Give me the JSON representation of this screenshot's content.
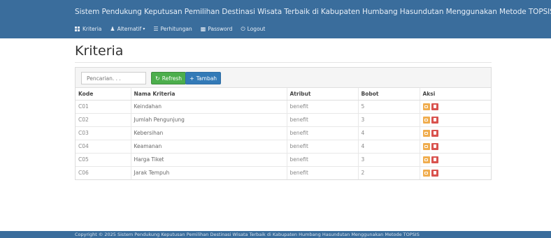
{
  "header": {
    "app_title": "Sistem Pendukung Keputusan Pemilihan Destinasi Wisata Terbaik di Kabupaten Humbang Hasundutan Menggunakan Metode TOPSIS"
  },
  "menu": {
    "kriteria": "Kriteria",
    "alternatif": "Alternatif",
    "perhitungan": "Perhitungan",
    "password": "Password",
    "logout": "Logout"
  },
  "page": {
    "title": "Kriteria"
  },
  "toolbar": {
    "search_placeholder": "Pencarian. . .",
    "refresh_label": "Refresh",
    "add_label": "Tambah"
  },
  "table": {
    "headers": [
      "Kode",
      "Nama Kriteria",
      "Atribut",
      "Bobot",
      "Aksi"
    ],
    "rows": [
      {
        "kode": "C01",
        "nama": "Keindahan",
        "atribut": "benefit",
        "bobot": "5"
      },
      {
        "kode": "C02",
        "nama": "Jumlah Pengunjung",
        "atribut": "benefit",
        "bobot": "3"
      },
      {
        "kode": "C03",
        "nama": "Kebersihan",
        "atribut": "benefit",
        "bobot": "4"
      },
      {
        "kode": "C04",
        "nama": "Keamanan",
        "atribut": "benefit",
        "bobot": "4"
      },
      {
        "kode": "C05",
        "nama": "Harga Tiket",
        "atribut": "benefit",
        "bobot": "3"
      },
      {
        "kode": "C06",
        "nama": "Jarak Tempuh",
        "atribut": "benefit",
        "bobot": "2"
      }
    ]
  },
  "footer": {
    "text": "Copyright © 2025 Sistem Pendukung Keputusan Pemilihan Destinasi Wisata Terbaik di Kabupaten Humbang Hasundutan Menggunakan Metode TOPSIS"
  },
  "colors": {
    "navbar": "#3a6d9c",
    "refresh": "#4cae4c",
    "add": "#337ab7",
    "edit": "#f0ad4e",
    "delete": "#d9534f"
  },
  "icons": {
    "kriteria": "grid-icon",
    "alternatif": "user-icon",
    "perhitungan": "list-icon",
    "password": "lock-icon",
    "logout": "power-icon",
    "refresh": "refresh-icon",
    "add": "plus-icon",
    "edit": "edit-icon",
    "delete": "trash-icon"
  }
}
